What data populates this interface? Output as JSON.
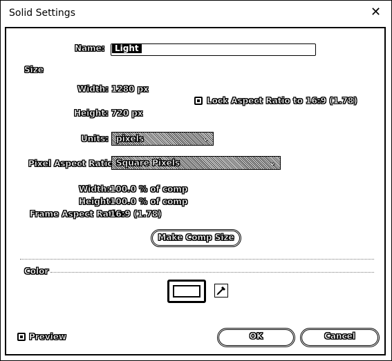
{
  "window": {
    "title": "Solid Settings",
    "close_glyph": "✕"
  },
  "name": {
    "label": "Name:",
    "value": "Light"
  },
  "size": {
    "section_label": "Size",
    "width_label": "Width:",
    "width_value": "1280 px",
    "height_label": "Height:",
    "height_value": "720 px",
    "lock_label": "Lock Aspect Ratio to 16:9 (1.78)",
    "units_label": "Units:",
    "units_value": "pixels",
    "par_label": "Pixel Aspect Ratio:",
    "par_value": "Square Pixels",
    "comp_width_label": "Width:",
    "comp_width_value": "100.0 % of comp",
    "comp_height_label": "Height:",
    "comp_height_value": "100.0 % of comp",
    "far_label": "Frame Aspect Ratio:",
    "far_value": "16:9 (1.78)",
    "make_comp_size": "Make Comp Size"
  },
  "color": {
    "section_label": "Color",
    "swatch_hex": "#FFFFFF"
  },
  "footer": {
    "preview_label": "Preview",
    "ok_label": "OK",
    "cancel_label": "Cancel"
  },
  "icons": {
    "close": "close-icon",
    "eyedropper": "eyedropper-icon",
    "chevron": "chevron-down-icon"
  }
}
